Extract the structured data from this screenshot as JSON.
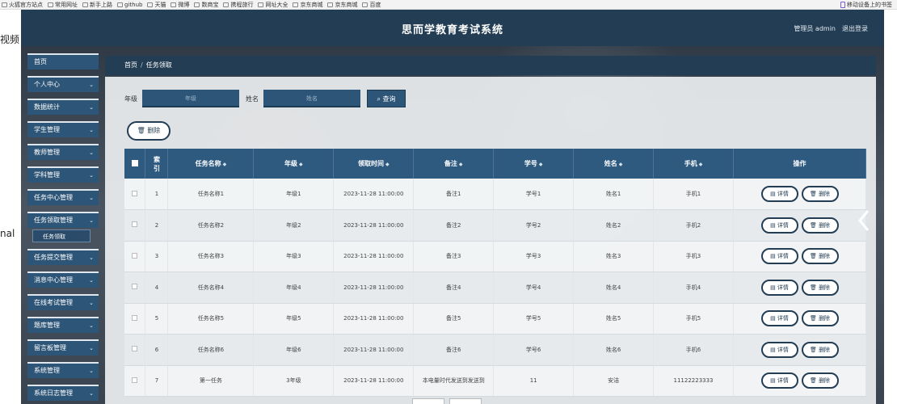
{
  "bookmarks": [
    "火狐官方站点",
    "常用网址",
    "新手上路",
    "github",
    "天猫",
    "微博",
    "数商宝",
    "携程旅行",
    "网址大全",
    "京东商城",
    "京东商城",
    "百度"
  ],
  "bookmark_right": "移动设备上的书签",
  "outside": {
    "top_left": "视频",
    "mid_left": "nal"
  },
  "header": {
    "title": "思而学教育考试系统",
    "user": "管理员 admin",
    "logout": "退出登录"
  },
  "sidebar": {
    "items": [
      {
        "label": "首页",
        "chevron": false
      },
      {
        "label": "个人中心",
        "chevron": true
      },
      {
        "label": "数据统计",
        "chevron": true
      },
      {
        "label": "学生管理",
        "chevron": true
      },
      {
        "label": "教师管理",
        "chevron": true
      },
      {
        "label": "学科管理",
        "chevron": true
      },
      {
        "label": "任务中心管理",
        "chevron": true
      },
      {
        "label": "任务领取管理",
        "chevron": true
      },
      {
        "label": "任务提交管理",
        "chevron": true
      },
      {
        "label": "消息中心管理",
        "chevron": true
      },
      {
        "label": "在线考试管理",
        "chevron": true
      },
      {
        "label": "题库管理",
        "chevron": true
      },
      {
        "label": "留言板管理",
        "chevron": true
      },
      {
        "label": "系统管理",
        "chevron": true
      },
      {
        "label": "系统日志管理",
        "chevron": true
      }
    ],
    "sub_item": "任务领取",
    "chevron_symbol": "⌄"
  },
  "breadcrumb": {
    "home": "首页",
    "sep": "/",
    "current": "任务领取"
  },
  "filter": {
    "grade_label": "年级",
    "grade_placeholder": "年级",
    "name_label": "姓名",
    "name_placeholder": "姓名",
    "query_button": "查询"
  },
  "delete_button": "删除",
  "table": {
    "headers": [
      "索引",
      "任务名称",
      "年级",
      "领取时间",
      "备注",
      "学号",
      "姓名",
      "手机",
      "操作"
    ],
    "sortable": [
      false,
      true,
      true,
      true,
      true,
      true,
      true,
      true,
      false
    ],
    "rows": [
      [
        "1",
        "任务名称1",
        "年级1",
        "2023-11-28 11:00:00",
        "备注1",
        "学号1",
        "姓名1",
        "手机1"
      ],
      [
        "2",
        "任务名称2",
        "年级2",
        "2023-11-28 11:00:00",
        "备注2",
        "学号2",
        "姓名2",
        "手机2"
      ],
      [
        "3",
        "任务名称3",
        "年级3",
        "2023-11-28 11:00:00",
        "备注3",
        "学号3",
        "姓名3",
        "手机3"
      ],
      [
        "4",
        "任务名称4",
        "年级4",
        "2023-11-28 11:00:00",
        "备注4",
        "学号4",
        "姓名4",
        "手机4"
      ],
      [
        "5",
        "任务名称5",
        "年级5",
        "2023-11-28 11:00:00",
        "备注5",
        "学号5",
        "姓名5",
        "手机5"
      ],
      [
        "6",
        "任务名称6",
        "年级6",
        "2023-11-28 11:00:00",
        "备注6",
        "学号6",
        "姓名6",
        "手机6"
      ],
      [
        "7",
        "第一任务",
        "3年级",
        "2023-11-28 11:00:00",
        "本电量时代发送到发送到",
        "11",
        "安洁",
        "11122223333"
      ]
    ],
    "detail_label": "详情",
    "delete_label": "删除"
  },
  "colors": {
    "accent": "#2d5577",
    "header": "#233e54",
    "table_header": "#2e5a80"
  }
}
